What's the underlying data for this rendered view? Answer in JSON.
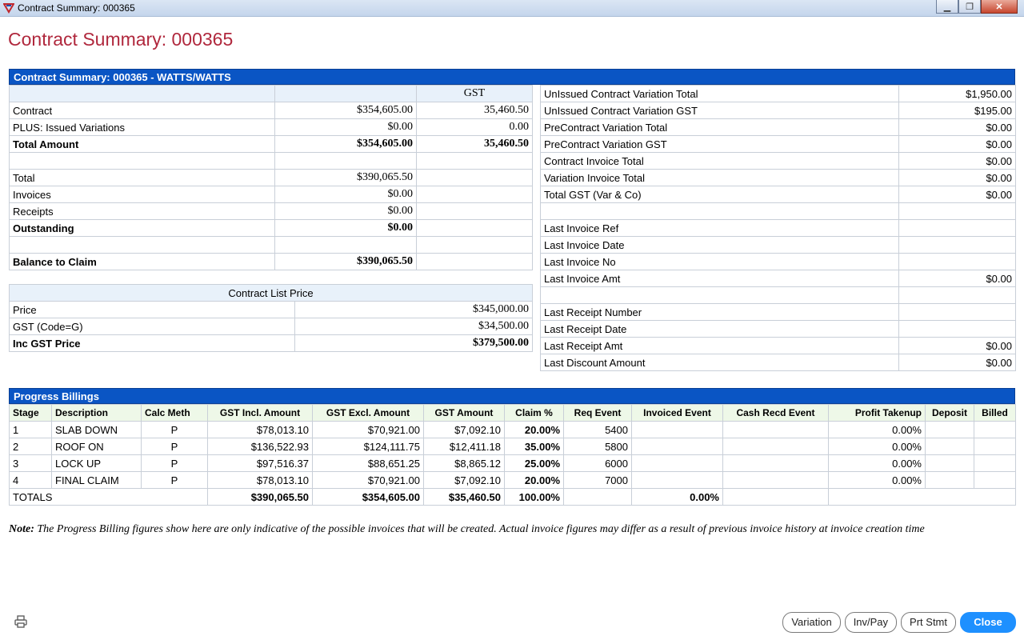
{
  "window": {
    "title": "Contract Summary: 000365"
  },
  "page_title": "Contract Summary: 000365",
  "summary": {
    "header": "Contract Summary: 000365 - WATTS/WATTS",
    "gst_col": "GST",
    "rows": [
      {
        "label": "Contract",
        "amount": "$354,605.00",
        "gst": "35,460.50",
        "bold": false
      },
      {
        "label": "PLUS: Issued Variations",
        "amount": "$0.00",
        "gst": "0.00",
        "bold": false
      },
      {
        "label": "Total Amount",
        "amount": "$354,605.00",
        "gst": "35,460.50",
        "bold": true
      },
      {
        "label": "",
        "amount": "",
        "gst": "",
        "bold": false
      },
      {
        "label": "Total",
        "amount": "$390,065.50",
        "gst": "",
        "bold": false
      },
      {
        "label": "Invoices",
        "amount": "$0.00",
        "gst": "",
        "bold": false
      },
      {
        "label": "Receipts",
        "amount": "$0.00",
        "gst": "",
        "bold": false
      },
      {
        "label": "Outstanding",
        "amount": "$0.00",
        "gst": "",
        "bold": true
      },
      {
        "label": "",
        "amount": "",
        "gst": "",
        "bold": false
      },
      {
        "label": "Balance to Claim",
        "amount": "$390,065.50",
        "gst": "",
        "bold": true
      }
    ]
  },
  "list_price": {
    "header": "Contract List Price",
    "rows": [
      {
        "label": "Price",
        "value": "$345,000.00",
        "bold": false
      },
      {
        "label": "GST (Code=G)",
        "value": "$34,500.00",
        "bold": false
      },
      {
        "label": "Inc GST Price",
        "value": "$379,500.00",
        "bold": true
      }
    ]
  },
  "right_info": [
    {
      "label": "UnIssued Contract Variation Total",
      "value": "$1,950.00"
    },
    {
      "label": "UnIssued Contract Variation GST",
      "value": "$195.00"
    },
    {
      "label": "PreContract Variation Total",
      "value": "$0.00"
    },
    {
      "label": "PreContract Variation GST",
      "value": "$0.00"
    },
    {
      "label": "Contract Invoice Total",
      "value": "$0.00"
    },
    {
      "label": "Variation Invoice Total",
      "value": "$0.00"
    },
    {
      "label": "Total GST (Var & Co)",
      "value": "$0.00"
    },
    {
      "label": "",
      "value": ""
    },
    {
      "label": "Last Invoice Ref",
      "value": ""
    },
    {
      "label": "Last Invoice Date",
      "value": ""
    },
    {
      "label": "Last Invoice No",
      "value": ""
    },
    {
      "label": "Last Invoice Amt",
      "value": "$0.00"
    },
    {
      "label": "",
      "value": ""
    },
    {
      "label": "Last Receipt Number",
      "value": ""
    },
    {
      "label": "Last Receipt Date",
      "value": ""
    },
    {
      "label": "Last Receipt Amt",
      "value": "$0.00"
    },
    {
      "label": "Last Discount Amount",
      "value": "$0.00"
    }
  ],
  "progress": {
    "header": "Progress Billings",
    "columns": [
      "Stage",
      "Description",
      "Calc Meth",
      "GST Incl. Amount",
      "GST Excl. Amount",
      "GST Amount",
      "Claim %",
      "Req Event",
      "Invoiced Event",
      "Cash Recd Event",
      "Profit Takenup",
      "Deposit",
      "Billed"
    ],
    "rows": [
      [
        "1",
        "SLAB DOWN",
        "P",
        "$78,013.10",
        "$70,921.00",
        "$7,092.10",
        "20.00%",
        "5400",
        "",
        "",
        "0.00%",
        "",
        ""
      ],
      [
        "2",
        "ROOF ON",
        "P",
        "$136,522.93",
        "$124,111.75",
        "$12,411.18",
        "35.00%",
        "5800",
        "",
        "",
        "0.00%",
        "",
        ""
      ],
      [
        "3",
        "LOCK UP",
        "P",
        "$97,516.37",
        "$88,651.25",
        "$8,865.12",
        "25.00%",
        "6000",
        "",
        "",
        "0.00%",
        "",
        ""
      ],
      [
        "4",
        "FINAL CLAIM",
        "P",
        "$78,013.10",
        "$70,921.00",
        "$7,092.10",
        "20.00%",
        "7000",
        "",
        "",
        "0.00%",
        "",
        ""
      ]
    ],
    "totals": {
      "label": "TOTALS",
      "incl": "$390,065.50",
      "excl": "$354,605.00",
      "gst": "$35,460.50",
      "claim": "100.00%",
      "invoiced": "0.00%"
    }
  },
  "note": {
    "prefix": "Note:",
    "text": " The Progress Billing figures show here are only indicative of the possible invoices that will be created. Actual invoice figures may differ as a result of previous invoice history at invoice creation time"
  },
  "buttons": {
    "variation": "Variation",
    "invpay": "Inv/Pay",
    "prtstmt": "Prt Stmt",
    "close": "Close"
  },
  "icons": {
    "app": "app-logo-icon",
    "print": "printer-icon"
  },
  "colors": {
    "title": "#b0283d",
    "header": "#0a55c4",
    "primary": "#1e90ff"
  }
}
